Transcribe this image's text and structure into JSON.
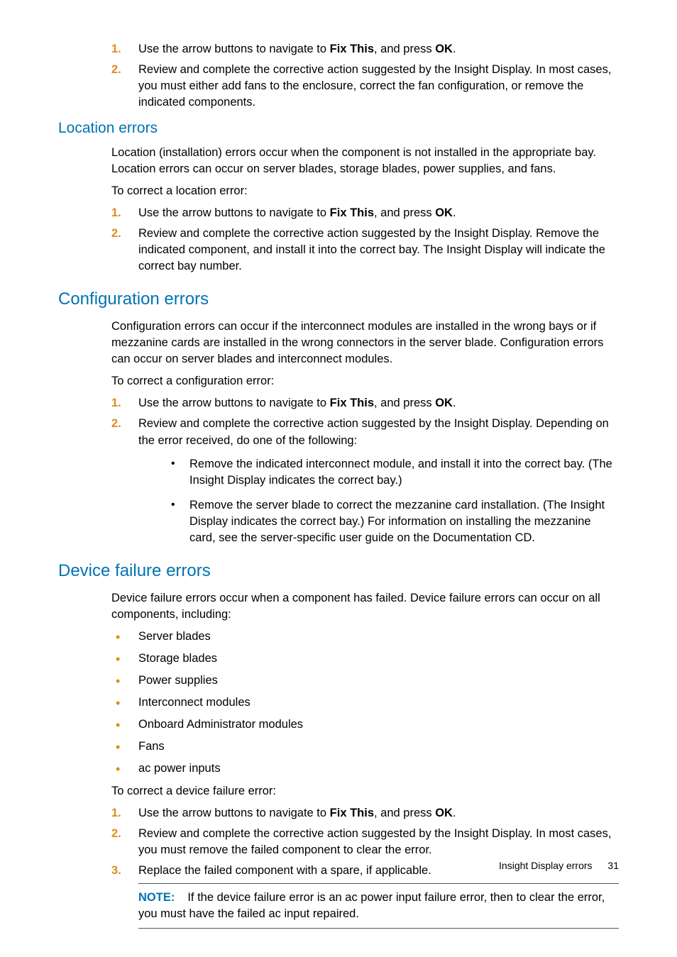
{
  "intro_list": [
    {
      "n": "1.",
      "pre": "Use the arrow buttons to navigate to ",
      "b1": "Fix This",
      "mid": ", and press ",
      "b2": "OK",
      "post": "."
    },
    {
      "n": "2.",
      "text": "Review and complete the corrective action suggested by the Insight Display. In most cases, you must either add fans to the enclosure, correct the fan configuration, or remove the indicated components."
    }
  ],
  "loc": {
    "heading": "Location errors",
    "p1": "Location (installation) errors occur when the component is not installed in the appropriate bay. Location errors can occur on server blades, storage blades, power supplies, and fans.",
    "p2": "To correct a location error:",
    "list": [
      {
        "n": "1.",
        "pre": "Use the arrow buttons to navigate to ",
        "b1": "Fix This",
        "mid": ", and press ",
        "b2": "OK",
        "post": "."
      },
      {
        "n": "2.",
        "text": "Review and complete the corrective action suggested by the Insight Display. Remove the indicated component, and install it into the correct bay. The Insight Display will indicate the correct bay number."
      }
    ]
  },
  "cfg": {
    "heading": "Configuration errors",
    "p1": "Configuration errors can occur if the interconnect modules are installed in the wrong bays or if mezzanine cards are installed in the wrong connectors in the server blade. Configuration errors can occur on server blades and interconnect modules.",
    "p2": "To correct a configuration error:",
    "list": [
      {
        "n": "1.",
        "pre": "Use the arrow buttons to navigate to ",
        "b1": "Fix This",
        "mid": ", and press ",
        "b2": "OK",
        "post": "."
      },
      {
        "n": "2.",
        "text": "Review and complete the corrective action suggested by the Insight Display. Depending on the error received, do one of the following:"
      }
    ],
    "sub": [
      "Remove the indicated interconnect module, and install it into the correct bay. (The Insight Display indicates the correct bay.)",
      "Remove the server blade to correct the mezzanine card installation. (The Insight Display indicates the correct bay.) For information on installing the mezzanine card, see the server-specific user guide on the Documentation CD."
    ]
  },
  "dev": {
    "heading": "Device failure errors",
    "p1": "Device failure errors occur when a component has failed. Device failure errors can occur on all components, including:",
    "bullets": [
      "Server blades",
      "Storage blades",
      "Power supplies",
      "Interconnect modules",
      "Onboard Administrator modules",
      "Fans",
      "ac power inputs"
    ],
    "p2": "To correct a device failure error:",
    "list": [
      {
        "n": "1.",
        "pre": "Use the arrow buttons to navigate to ",
        "b1": "Fix This",
        "mid": ", and press ",
        "b2": "OK",
        "post": "."
      },
      {
        "n": "2.",
        "text": "Review and complete the corrective action suggested by the Insight Display. In most cases, you must remove the failed component to clear the error."
      },
      {
        "n": "3.",
        "text": "Replace the failed component with a spare, if applicable."
      }
    ],
    "note_label": "NOTE:",
    "note_text": "If the device failure error is an ac power input failure error, then to clear the error, you must have the failed ac input repaired."
  },
  "footer": {
    "text": "Insight Display errors",
    "page": "31"
  }
}
